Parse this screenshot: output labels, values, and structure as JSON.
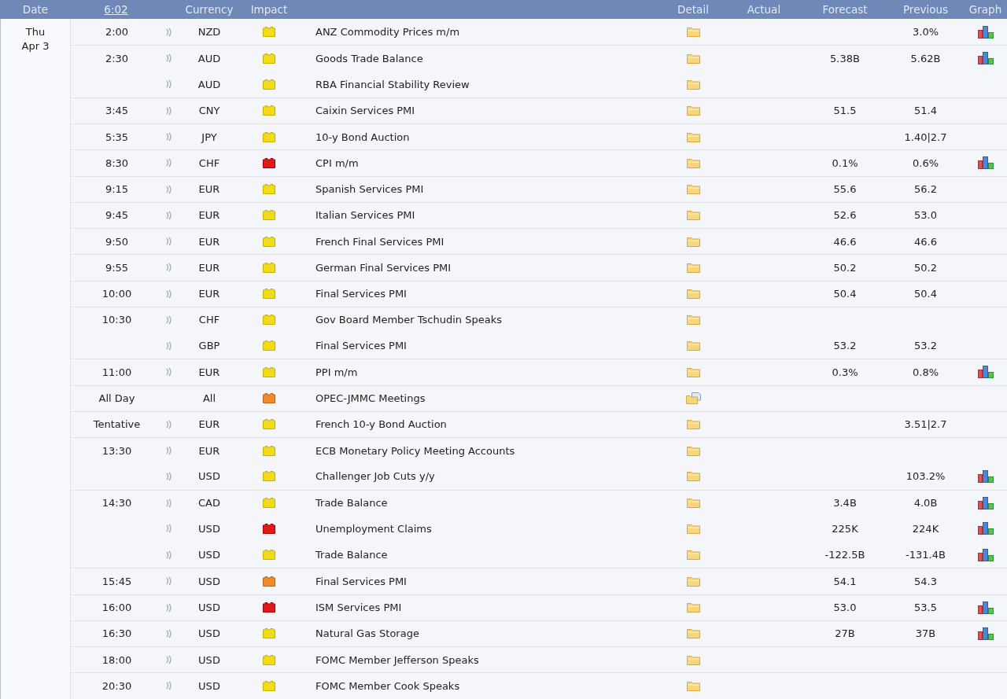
{
  "header": {
    "columns": [
      "Date",
      "6:02",
      "Currency",
      "Impact",
      "Detail",
      "Actual",
      "Forecast",
      "Previous",
      "Graph"
    ]
  },
  "day": {
    "weekday": "Thu",
    "date": "Apr 3"
  },
  "rows": [
    {
      "time": "2:00",
      "sound": true,
      "currency": "NZD",
      "kind": "low",
      "event": "ANZ Commodity Prices m/m",
      "detail_note": false,
      "previous": "3.0%",
      "graph": true
    },
    {
      "time": "2:30",
      "sound": true,
      "currency": "AUD",
      "kind": "low",
      "event": "Goods Trade Balance",
      "detail_note": false,
      "forecast": "5.38B",
      "previous": "5.62B",
      "graph": true
    },
    {
      "sound": true,
      "currency": "AUD",
      "kind": "low",
      "event": "RBA Financial Stability Review",
      "detail_note": false,
      "graph": false
    },
    {
      "time": "3:45",
      "sound": true,
      "currency": "CNY",
      "kind": "low",
      "event": "Caixin Services PMI",
      "detail_note": false,
      "forecast": "51.5",
      "previous": "51.4",
      "graph": false
    },
    {
      "time": "5:35",
      "sound": true,
      "currency": "JPY",
      "kind": "low",
      "event": "10-y Bond Auction",
      "detail_note": false,
      "previous": "1.40|2.7",
      "graph": false
    },
    {
      "time": "8:30",
      "sound": true,
      "currency": "CHF",
      "kind": "high",
      "event": "CPI m/m",
      "detail_note": false,
      "forecast": "0.1%",
      "previous": "0.6%",
      "graph": true
    },
    {
      "time": "9:15",
      "sound": true,
      "currency": "EUR",
      "kind": "low",
      "event": "Spanish Services PMI",
      "detail_note": false,
      "forecast": "55.6",
      "previous": "56.2",
      "graph": false
    },
    {
      "time": "9:45",
      "sound": true,
      "currency": "EUR",
      "kind": "low",
      "event": "Italian Services PMI",
      "detail_note": false,
      "forecast": "52.6",
      "previous": "53.0",
      "graph": false
    },
    {
      "time": "9:50",
      "sound": true,
      "currency": "EUR",
      "kind": "low",
      "event": "French Final Services PMI",
      "detail_note": false,
      "forecast": "46.6",
      "previous": "46.6",
      "graph": false
    },
    {
      "time": "9:55",
      "sound": true,
      "currency": "EUR",
      "kind": "low",
      "event": "German Final Services PMI",
      "detail_note": false,
      "forecast": "50.2",
      "previous": "50.2",
      "graph": false
    },
    {
      "time": "10:00",
      "sound": true,
      "currency": "EUR",
      "kind": "low",
      "event": "Final Services PMI",
      "detail_note": false,
      "forecast": "50.4",
      "previous": "50.4",
      "graph": false
    },
    {
      "time": "10:30",
      "sound": true,
      "currency": "CHF",
      "kind": "low",
      "event": "Gov Board Member Tschudin Speaks",
      "detail_note": false,
      "graph": false
    },
    {
      "sound": true,
      "currency": "GBP",
      "kind": "low",
      "event": "Final Services PMI",
      "detail_note": false,
      "forecast": "53.2",
      "previous": "53.2",
      "graph": false
    },
    {
      "time": "11:00",
      "sound": true,
      "currency": "EUR",
      "kind": "low",
      "event": "PPI m/m",
      "detail_note": false,
      "forecast": "0.3%",
      "previous": "0.8%",
      "graph": true
    },
    {
      "time": "All Day",
      "sound": false,
      "currency": "All",
      "kind": "medium",
      "event": "OPEC-JMMC Meetings",
      "detail_note": true,
      "graph": false
    },
    {
      "time": "Tentative",
      "sound": true,
      "currency": "EUR",
      "kind": "low",
      "event": "French 10-y Bond Auction",
      "detail_note": false,
      "previous": "3.51|2.7",
      "graph": false
    },
    {
      "time": "13:30",
      "sound": true,
      "currency": "EUR",
      "kind": "low",
      "event": "ECB Monetary Policy Meeting Accounts",
      "detail_note": false,
      "graph": false
    },
    {
      "sound": true,
      "currency": "USD",
      "kind": "low",
      "event": "Challenger Job Cuts y/y",
      "detail_note": false,
      "previous": "103.2%",
      "graph": true
    },
    {
      "time": "14:30",
      "sound": true,
      "currency": "CAD",
      "kind": "low",
      "event": "Trade Balance",
      "detail_note": false,
      "forecast": "3.4B",
      "previous": "4.0B",
      "graph": true
    },
    {
      "sound": true,
      "currency": "USD",
      "kind": "high",
      "event": "Unemployment Claims",
      "detail_note": false,
      "forecast": "225K",
      "previous": "224K",
      "graph": true
    },
    {
      "sound": true,
      "currency": "USD",
      "kind": "low",
      "event": "Trade Balance",
      "detail_note": false,
      "forecast": "-122.5B",
      "previous": "-131.4B",
      "graph": true
    },
    {
      "time": "15:45",
      "sound": true,
      "currency": "USD",
      "kind": "medium",
      "event": "Final Services PMI",
      "detail_note": false,
      "forecast": "54.1",
      "previous": "54.3",
      "graph": false
    },
    {
      "time": "16:00",
      "sound": true,
      "currency": "USD",
      "kind": "high",
      "event": "ISM Services PMI",
      "detail_note": false,
      "forecast": "53.0",
      "previous": "53.5",
      "graph": true
    },
    {
      "time": "16:30",
      "sound": true,
      "currency": "USD",
      "kind": "low",
      "event": "Natural Gas Storage",
      "detail_note": false,
      "forecast": "27B",
      "previous": "37B",
      "graph": true
    },
    {
      "time": "18:00",
      "sound": true,
      "currency": "USD",
      "kind": "low",
      "event": "FOMC Member Jefferson Speaks",
      "detail_note": false,
      "graph": false
    },
    {
      "time": "20:30",
      "sound": true,
      "currency": "USD",
      "kind": "low",
      "event": "FOMC Member Cook Speaks",
      "detail_note": false,
      "graph": false
    }
  ]
}
